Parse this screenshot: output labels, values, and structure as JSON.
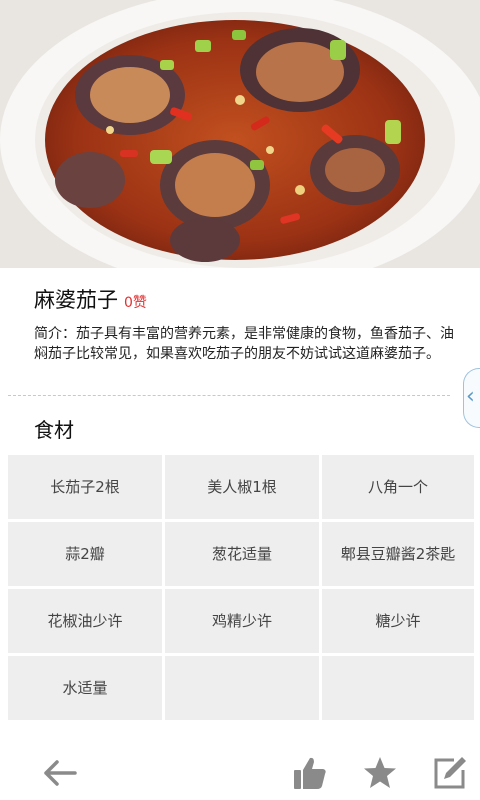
{
  "recipe": {
    "title": "麻婆茄子",
    "likes": "0赞",
    "intro": "简介：茄子具有丰富的营养元素，是非常健康的食物，鱼香茄子、油焖茄子比较常见，如果喜欢吃茄子的朋友不妨试试这道麻婆茄子。"
  },
  "ingredients": {
    "title": "食材",
    "items": [
      "长茄子2根",
      "美人椒1根",
      "八角一个",
      "蒜2瓣",
      "葱花适量",
      "郫县豆瓣酱2茶匙",
      "花椒油少许",
      "鸡精少许",
      "糖少许",
      "水适量"
    ]
  },
  "icons": {
    "back": "back-arrow-icon",
    "like": "thumbs-up-icon",
    "favorite": "star-icon",
    "edit": "edit-icon",
    "side_tab": "chevron-left-icon"
  },
  "colors": {
    "likes": "#e23030",
    "icon": "#888888",
    "grid_cell": "#eeeeee"
  }
}
